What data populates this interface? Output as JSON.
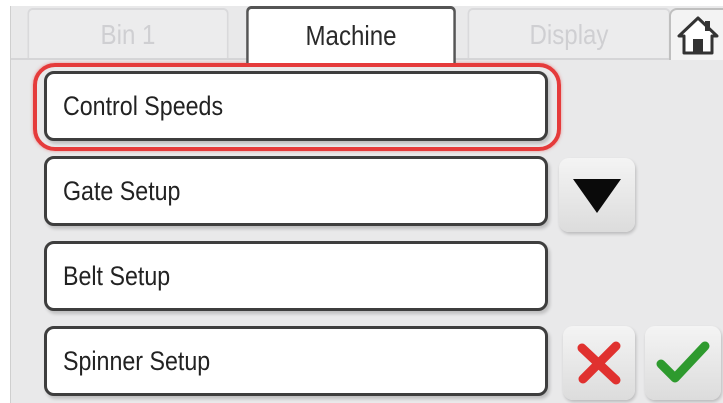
{
  "tabs": [
    {
      "label": "Bin 1",
      "active": false
    },
    {
      "label": "Machine",
      "active": true
    },
    {
      "label": "Display",
      "active": false
    }
  ],
  "home": {
    "icon": "home-icon"
  },
  "menu": {
    "items": [
      {
        "label": "Control Speeds",
        "selected": true
      },
      {
        "label": "Gate Setup",
        "selected": false
      },
      {
        "label": "Belt Setup",
        "selected": false
      },
      {
        "label": "Spinner Setup",
        "selected": false
      }
    ]
  },
  "controls": {
    "scroll_down_icon": "down-triangle-icon",
    "cancel_icon": "red-x-icon",
    "confirm_icon": "green-check-icon"
  },
  "colors": {
    "highlight": "#e53b3b",
    "cancel": "#e0312f",
    "confirm": "#2e9a2e"
  }
}
